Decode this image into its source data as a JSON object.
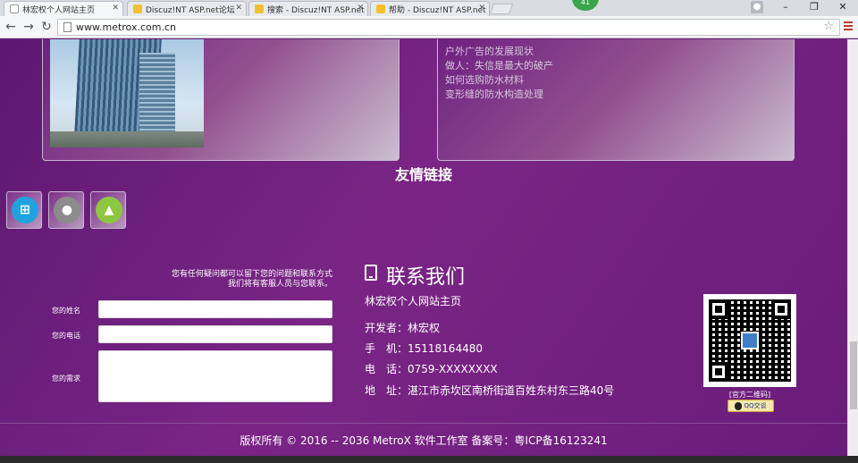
{
  "tabs": [
    {
      "title": "林宏权个人网站主页",
      "active": true
    },
    {
      "title": "Discuz!NT ASP.net论坛",
      "active": false
    },
    {
      "title": "搜索 - Discuz!NT ASP.net",
      "active": false
    },
    {
      "title": "帮助 - Discuz!NT ASP.net",
      "active": false
    }
  ],
  "browser": {
    "url": "www.metrox.com.cn",
    "extension_badge": "41"
  },
  "news": [
    "户外广告的发展现状",
    "做人：失信是最大的破产",
    "如何选购防水材料",
    "变形缝的防水构造处理"
  ],
  "friends": {
    "title": "友情链接",
    "icons": [
      "windows-icon",
      "apple-icon",
      "android-icon"
    ]
  },
  "form": {
    "intro_line1": "您有任何疑问都可以留下您的问题和联系方式",
    "intro_line2": "我们将有客服人员与您联系。",
    "name_label": "您的姓名",
    "phone_label": "您的电话",
    "need_label": "您的需求",
    "name_value": "",
    "phone_value": "",
    "need_value": ""
  },
  "contact": {
    "title": "联系我们",
    "site": "林宏权个人网站主页",
    "developer": "开发者：林宏权",
    "mobile": "手　机：15118164480",
    "tel": "电　话：0759-XXXXXXXX",
    "address": "地　址：湛江市赤坎区南桥街道百姓东村东三路40号"
  },
  "qr": {
    "caption": "[官方二维码]",
    "qq_label": "QQ交谈"
  },
  "footer": {
    "copyright": "版权所有 © 2016 -- 2036 MetroX 软件工作室 备案号：粤ICP备16123241"
  }
}
